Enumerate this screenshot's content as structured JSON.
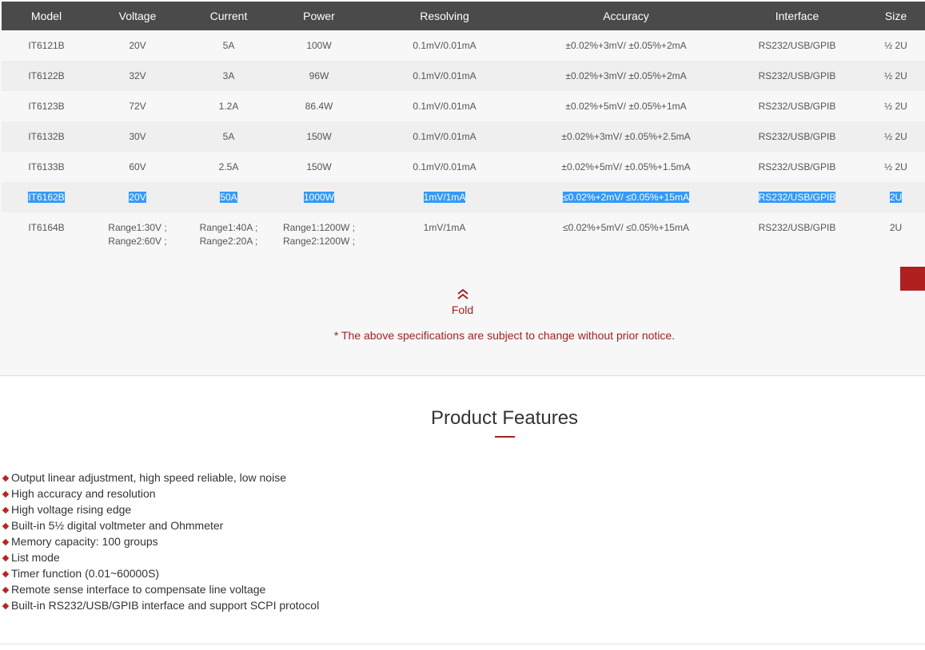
{
  "table": {
    "headers": [
      "Model",
      "Voltage",
      "Current",
      "Power",
      "Resolving",
      "Accuracy",
      "Interface",
      "Size"
    ],
    "rows": [
      [
        "IT6121B",
        "20V",
        "5A",
        "100W",
        "0.1mV/0.01mA",
        "±0.02%+3mV/ ±0.05%+2mA",
        "RS232/USB/GPIB",
        "½ 2U"
      ],
      [
        "IT6122B",
        "32V",
        "3A",
        "96W",
        "0.1mV/0.01mA",
        "±0.02%+3mV/ ±0.05%+2mA",
        "RS232/USB/GPIB",
        "½ 2U"
      ],
      [
        "IT6123B",
        "72V",
        "1.2A",
        "86.4W",
        "0.1mV/0.01mA",
        "±0.02%+5mV/ ±0.05%+1mA",
        "RS232/USB/GPIB",
        "½ 2U"
      ],
      [
        "IT6132B",
        "30V",
        "5A",
        "150W",
        "0.1mV/0.01mA",
        "±0.02%+3mV/ ±0.05%+2.5mA",
        "RS232/USB/GPIB",
        "½ 2U"
      ],
      [
        "IT6133B",
        "60V",
        "2.5A",
        "150W",
        "0.1mV/0.01mA",
        "±0.02%+5mV/ ±0.05%+1.5mA",
        "RS232/USB/GPIB",
        "½ 2U"
      ],
      [
        "IT6162B",
        "20V",
        "50A",
        "1000W",
        "1mV/1mA",
        "≤0.02%+2mV/ ≤0.05%+15mA",
        "RS232/USB/GPIB",
        "2U"
      ],
      [
        "IT6164B",
        "Range1:30V ;",
        "Range1:40A ;",
        "Range1:1200W ;",
        "1mV/1mA",
        "≤0.02%+5mV/ ≤0.05%+15mA",
        "RS232/USB/GPIB",
        "2U"
      ]
    ],
    "last_row_second_lines": [
      "Range2:60V ;",
      "Range2:20A ;",
      "Range2:1200W ;"
    ],
    "selected_row": "IT6162B"
  },
  "fold": {
    "label": "Fold",
    "icon": "double-chevron-up-icon"
  },
  "notice": "* The above specifications are subject to change without prior notice.",
  "features": {
    "title": "Product Features",
    "items": [
      "Output linear adjustment, high speed reliable, low noise",
      "High accuracy and resolution",
      "High voltage rising edge",
      "Built-in 5½ digital voltmeter and Ohmmeter",
      "Memory capacity: 100 groups",
      "List mode",
      "Timer function (0.01~60000S)",
      "Remote sense interface to compensate line voltage",
      "Built-in RS232/USB/GPIB interface and support SCPI protocol"
    ]
  },
  "colors": {
    "header_bg": "#4a4a4a",
    "accent_red": "#a3221f",
    "selection_blue": "#3399ff"
  }
}
